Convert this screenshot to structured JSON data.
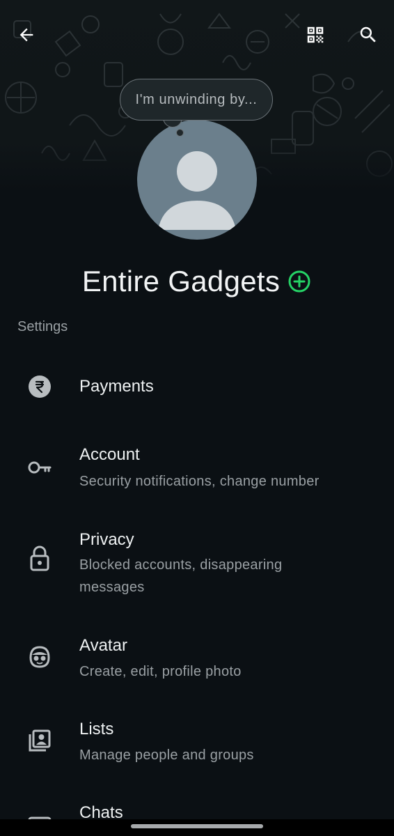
{
  "header": {
    "back_icon": "arrow-left-icon",
    "qr_icon": "qr-code-icon",
    "search_icon": "search-icon"
  },
  "profile": {
    "status_text": "I'm unwinding by...",
    "name": "Entire Gadgets",
    "add_icon": "plus-circle-icon",
    "accent_color": "#25d366"
  },
  "settings": {
    "section_label": "Settings",
    "items": [
      {
        "icon": "rupee-icon",
        "title": "Payments",
        "subtitle": ""
      },
      {
        "icon": "key-icon",
        "title": "Account",
        "subtitle": "Security notifications, change number"
      },
      {
        "icon": "lock-icon",
        "title": "Privacy",
        "subtitle": "Blocked accounts, disappearing messages"
      },
      {
        "icon": "avatar-face-icon",
        "title": "Avatar",
        "subtitle": "Create, edit, profile photo"
      },
      {
        "icon": "contact-list-icon",
        "title": "Lists",
        "subtitle": "Manage people and groups"
      },
      {
        "icon": "chat-icon",
        "title": "Chats",
        "subtitle": ""
      }
    ]
  },
  "colors": {
    "background": "#0b1014",
    "primary_text": "#e9edef",
    "secondary_text": "#9aa0a4",
    "avatar_bg": "#6b7f8c"
  }
}
